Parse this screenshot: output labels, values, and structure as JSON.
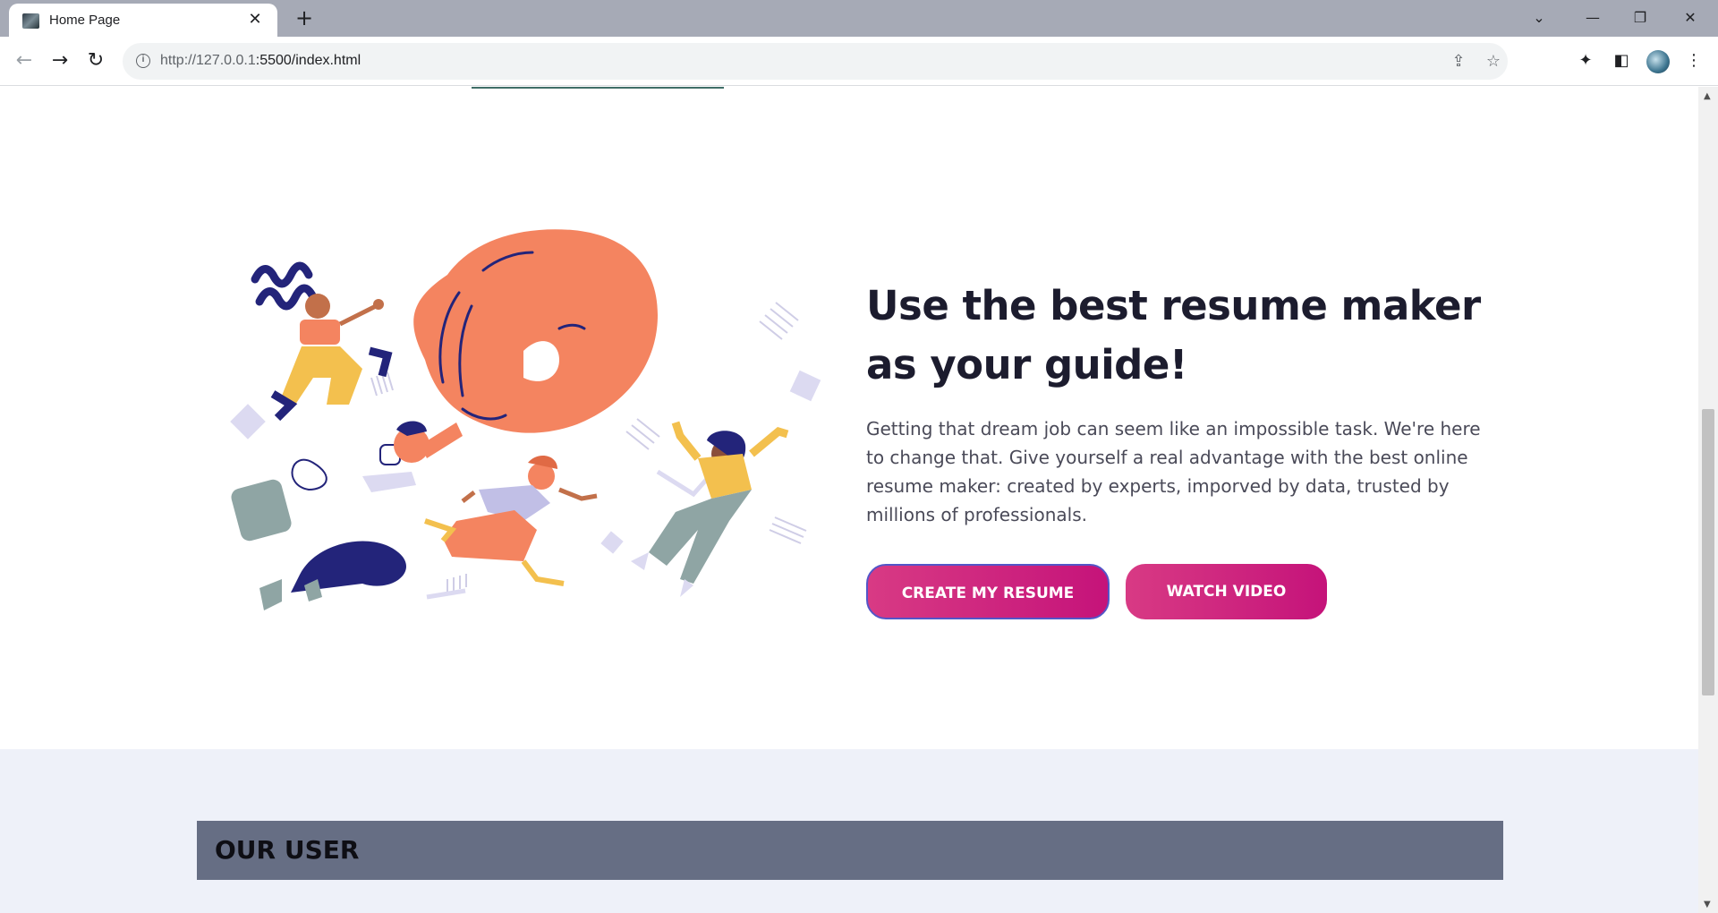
{
  "browser": {
    "tab_title": "Home Page",
    "tab_close": "✕",
    "new_tab": "+",
    "url_host": "http://127.0.0.1",
    "url_rest": ":5500/index.html",
    "window": {
      "chevron": "⌄",
      "minimize": "—",
      "restore": "❐",
      "close": "✕"
    }
  },
  "hero": {
    "title_line1": "Use the best resume maker",
    "title_line2": "as your guide!",
    "description": "Getting that dream job can seem like an impossible task. We're here to change that. Give yourself a real advantage with the best online resume maker: created by experts, imporved by data, trusted by millions of professionals.",
    "create_button": "CREATE MY RESUME",
    "watch_button": "WATCH VIDEO"
  },
  "users": {
    "title": "OUR USER"
  },
  "colors": {
    "accent_pink": "#d83a84",
    "hand_orange": "#f48460",
    "navy": "#23247a",
    "users_bar": "#666e84"
  }
}
